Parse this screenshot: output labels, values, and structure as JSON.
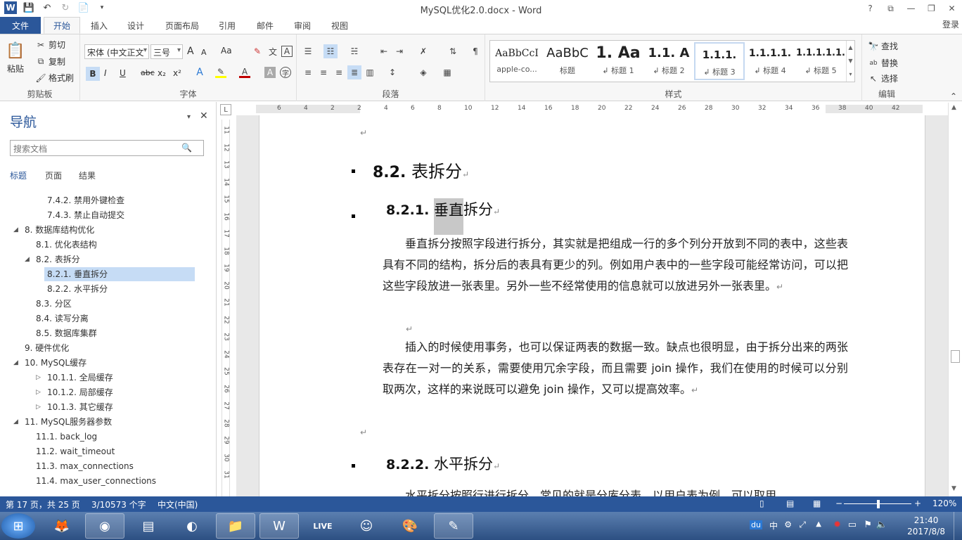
{
  "window": {
    "title": "MySQL优化2.0.docx - Word",
    "buttons": {
      "help": "?",
      "ribbon_display": "⧉",
      "minimize": "—",
      "restore": "❐",
      "close": "✕"
    },
    "login": "登录"
  },
  "tabs": [
    "文件",
    "开始",
    "插入",
    "设计",
    "页面布局",
    "引用",
    "邮件",
    "审阅",
    "视图"
  ],
  "ribbon": {
    "clipboard": {
      "label": "剪贴板",
      "paste": "粘贴",
      "cut": "剪切",
      "copy": "复制",
      "format_painter": "格式刷"
    },
    "font": {
      "label": "字体",
      "font_name": "宋体 (中文正文",
      "font_size": "三号",
      "grow": "A",
      "shrink": "A",
      "case": "Aa",
      "bold": "B",
      "italic": "I",
      "underline": "U",
      "strike": "abc",
      "subscript": "x₂",
      "superscript": "x²",
      "font_color_letter": "A"
    },
    "paragraph": {
      "label": "段落"
    },
    "styles": {
      "label": "样式",
      "items": [
        {
          "preview": "AaBbCcI",
          "name": "apple-co..."
        },
        {
          "preview": "AaBbC",
          "name": "标题"
        },
        {
          "preview": "1.  Aa",
          "name": "↲ 标题 1"
        },
        {
          "preview": "1.1.  A",
          "name": "↲ 标题 2"
        },
        {
          "preview": "1.1.1.",
          "name": "↲ 标题 3"
        },
        {
          "preview": "1.1.1.1.",
          "name": "↲ 标题 4"
        },
        {
          "preview": "1.1.1.1.1.",
          "name": "↲ 标题 5"
        }
      ]
    },
    "editing": {
      "label": "编辑",
      "find": "查找",
      "replace": "替换",
      "select": "选择"
    }
  },
  "nav": {
    "title": "导航",
    "search_placeholder": "搜索文档",
    "tabs": [
      "标题",
      "页面",
      "结果"
    ],
    "items": [
      {
        "text": "7.4.2. 禁用外键检查",
        "tri": ""
      },
      {
        "text": "7.4.3. 禁止自动提交",
        "tri": ""
      },
      {
        "text": "8. 数据库结构优化",
        "tri": "◢"
      },
      {
        "text": "8.1. 优化表结构",
        "tri": ""
      },
      {
        "text": "8.2. 表拆分",
        "tri": "◢"
      },
      {
        "text": "8.2.1. 垂直拆分",
        "tri": ""
      },
      {
        "text": "8.2.2. 水平拆分",
        "tri": ""
      },
      {
        "text": "8.3. 分区",
        "tri": ""
      },
      {
        "text": "8.4. 读写分离",
        "tri": ""
      },
      {
        "text": "8.5. 数据库集群",
        "tri": ""
      },
      {
        "text": "9. 硬件优化",
        "tri": ""
      },
      {
        "text": "10. MySQL缓存",
        "tri": "◢"
      },
      {
        "text": "10.1.1. 全局缓存",
        "tri": "▷"
      },
      {
        "text": "10.1.2. 局部缓存",
        "tri": "▷"
      },
      {
        "text": "10.1.3. 其它缓存",
        "tri": "▷"
      },
      {
        "text": "11. MySQL服务器参数",
        "tri": "◢"
      },
      {
        "text": "11.1. back_log",
        "tri": ""
      },
      {
        "text": "11.2. wait_timeout",
        "tri": ""
      },
      {
        "text": "11.3. max_connections",
        "tri": ""
      },
      {
        "text": "11.4. max_user_connections",
        "tri": ""
      }
    ]
  },
  "ruler": {
    "h": [
      "6",
      "4",
      "2",
      "2",
      "4",
      "6",
      "8",
      "10",
      "12",
      "14",
      "16",
      "18",
      "20",
      "22",
      "24",
      "26",
      "28",
      "30",
      "32",
      "34",
      "36",
      "38",
      "40",
      "42"
    ],
    "v": [
      "11",
      "12",
      "13",
      "14",
      "15",
      "16",
      "17",
      "18",
      "19",
      "20",
      "21",
      "22",
      "23",
      "24",
      "25",
      "26",
      "27",
      "28",
      "29",
      "30",
      "31"
    ]
  },
  "document": {
    "h2_num": "8.2.",
    "h2_text": "表拆分",
    "h3a_num": "8.2.1.",
    "h3a_hl": "垂直",
    "h3a_rest": "拆分",
    "para1": "垂直拆分按照字段进行拆分，其实就是把组成一行的多个列分开放到不同的表中，这些表具有不同的结构，拆分后的表具有更少的列。例如用户表中的一些字段可能经常访问，可以把这些字段放进一张表里。另外一些不经常使用的信息就可以放进另外一张表里。",
    "para2": "插入的时候使用事务，也可以保证两表的数据一致。缺点也很明显，由于拆分出来的两张表存在一对一的关系，需要使用冗余字段，而且需要 join 操作，我们在使用的时候可以分别取两次，这样的来说既可以避免 join 操作，又可以提高效率。",
    "h3b_num": "8.2.2.",
    "h3b_text": "水平拆分",
    "para3": "水平拆分按照行进行拆分，常见的就是分库分表。以用户表为例，可以取用",
    "pilcrow": "↵"
  },
  "status": {
    "page": "第 17 页，共 25 页",
    "words": "3/10573 个字",
    "language": "中文(中国)",
    "zoom": "120%"
  },
  "taskbar": {
    "clock_time": "21:40",
    "clock_date": "2017/8/8",
    "tray_items": [
      "du",
      "中",
      "⚙",
      "⤢"
    ]
  },
  "colors": {
    "accent": "#2b579a",
    "nav_selected": "#c6dcf5",
    "highlight": "#c8c8c8"
  }
}
